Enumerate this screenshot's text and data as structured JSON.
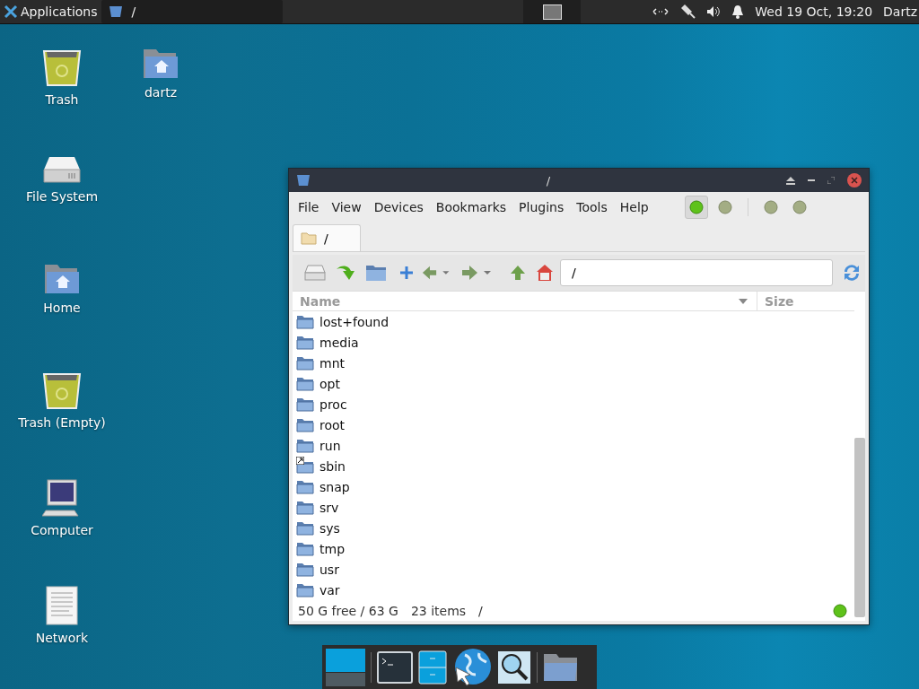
{
  "top_panel": {
    "applications_label": "Applications",
    "window_button": {
      "title": "/"
    },
    "clock": "Wed 19 Oct, 19:20",
    "user": "Dartz"
  },
  "desktop": {
    "columns": [
      [
        {
          "label": "Trash",
          "kind": "trash"
        },
        {
          "label": "File System",
          "kind": "drive"
        },
        {
          "label": "Home",
          "kind": "home"
        },
        {
          "label": "Trash (Empty)",
          "kind": "trash"
        },
        {
          "label": "Computer",
          "kind": "computer"
        },
        {
          "label": "Network",
          "kind": "document"
        }
      ],
      [
        {
          "label": "dartz",
          "kind": "home"
        }
      ]
    ]
  },
  "window": {
    "title": "/",
    "menu": [
      "File",
      "View",
      "Devices",
      "Bookmarks",
      "Plugins",
      "Tools",
      "Help"
    ],
    "pane_buttons": [
      {
        "selected": true
      },
      {
        "selected": false
      },
      {
        "selected": false
      },
      {
        "selected": false
      }
    ],
    "tabs": [
      {
        "label": "/",
        "selected": true
      }
    ],
    "path": "/",
    "columns": [
      "Name",
      "Size"
    ],
    "rows": [
      {
        "name": "lost+found",
        "link": false
      },
      {
        "name": "media",
        "link": false
      },
      {
        "name": "mnt",
        "link": false
      },
      {
        "name": "opt",
        "link": false
      },
      {
        "name": "proc",
        "link": false
      },
      {
        "name": "root",
        "link": false
      },
      {
        "name": "run",
        "link": false
      },
      {
        "name": "sbin",
        "link": true
      },
      {
        "name": "snap",
        "link": false
      },
      {
        "name": "srv",
        "link": false
      },
      {
        "name": "sys",
        "link": false
      },
      {
        "name": "tmp",
        "link": false
      },
      {
        "name": "usr",
        "link": false
      },
      {
        "name": "var",
        "link": false
      }
    ],
    "status": {
      "free": "50 G free / 63 G",
      "items": "23 items",
      "path": "/"
    }
  },
  "dock": [
    {
      "kind": "workspace"
    },
    {
      "kind": "terminal"
    },
    {
      "kind": "cabinet"
    },
    {
      "kind": "globe"
    },
    {
      "kind": "search"
    },
    {
      "kind": "folder"
    }
  ]
}
